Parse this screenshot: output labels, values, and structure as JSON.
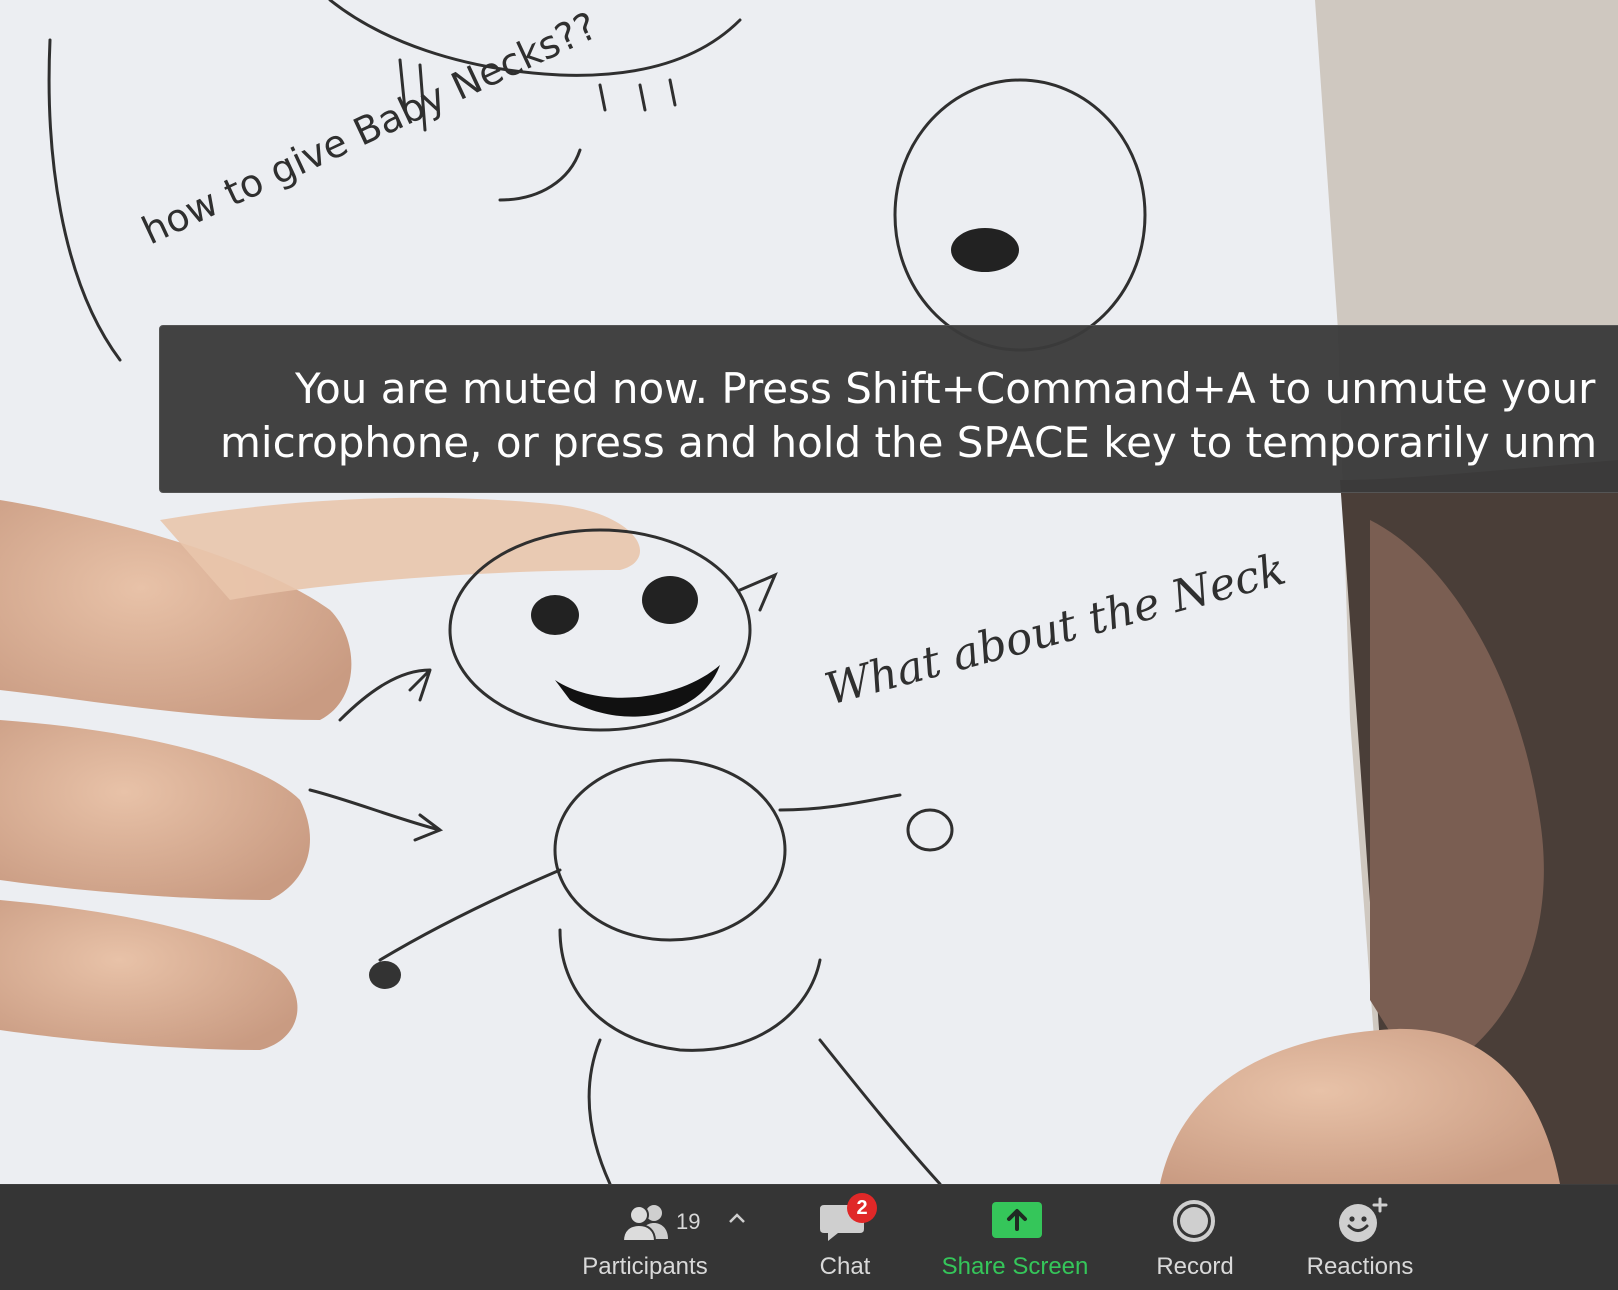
{
  "toast": {
    "line1": "You are muted now. Press Shift+Command+A to unmute your",
    "line2": "microphone, or press and hold the SPACE key to temporarily unm"
  },
  "video": {
    "drawing_text_top": "how to give Baby Necks??",
    "drawing_text_right": "What about the Neck"
  },
  "toolbar": {
    "participants": {
      "label": "Participants",
      "count": "19",
      "icon": "participants-icon"
    },
    "chat": {
      "label": "Chat",
      "badge": "2",
      "icon": "chat-bubble-icon"
    },
    "share": {
      "label": "Share Screen",
      "icon": "share-screen-icon",
      "color": "#35c65a"
    },
    "record": {
      "label": "Record",
      "icon": "record-icon"
    },
    "reactions": {
      "label": "Reactions",
      "icon": "reactions-icon"
    }
  }
}
